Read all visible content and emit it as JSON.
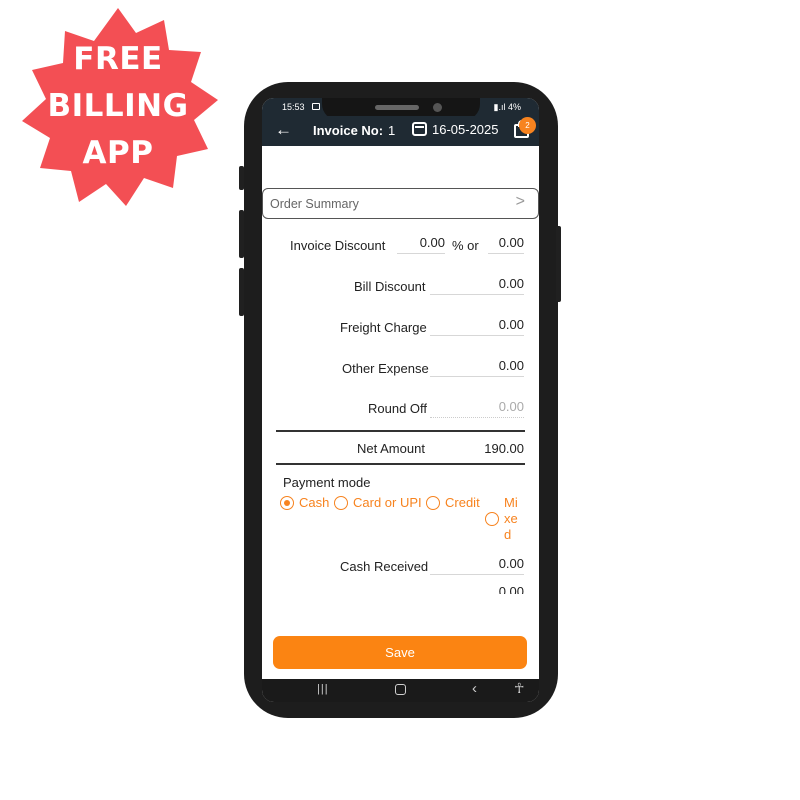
{
  "promo": {
    "line1": "FREE",
    "line2": "BILLING",
    "line3": "APP",
    "color": "#f34f54"
  },
  "status_bar": {
    "time": "15:53",
    "battery": "4%"
  },
  "app_bar": {
    "back_icon": "arrow-left-icon",
    "invoice_label": "Invoice No:",
    "invoice_number": "1",
    "date": "16-05-2025",
    "cart_count": "2"
  },
  "order_summary": {
    "label": "Order Summary"
  },
  "fields": {
    "invoice_discount_label": "Invoice Discount",
    "invoice_discount_value": "0.00",
    "percent_or": "% or",
    "invoice_discount_amount": "0.00",
    "bill_discount_label": "Bill Discount",
    "bill_discount_value": "0.00",
    "freight_charge_label": "Freight Charge",
    "freight_charge_value": "0.00",
    "other_expense_label": "Other Expense",
    "other_expense_value": "0.00",
    "round_off_label": "Round Off",
    "round_off_placeholder": "0.00",
    "net_amount_label": "Net Amount",
    "net_amount_value": "190.00"
  },
  "payment": {
    "title": "Payment mode",
    "options": [
      {
        "label": "Cash",
        "selected": true
      },
      {
        "label": "Card or UPI",
        "selected": false
      },
      {
        "label": "Credit",
        "selected": false
      },
      {
        "label": "Mixed",
        "selected": false
      }
    ],
    "mixed_wrapped": [
      "Mi",
      "xe",
      "d"
    ]
  },
  "cash": {
    "received_label": "Cash Received",
    "received_value": "0.00"
  },
  "actions": {
    "save_label": "Save"
  },
  "colors": {
    "accent": "#f7831f",
    "header": "#1f2a33"
  }
}
